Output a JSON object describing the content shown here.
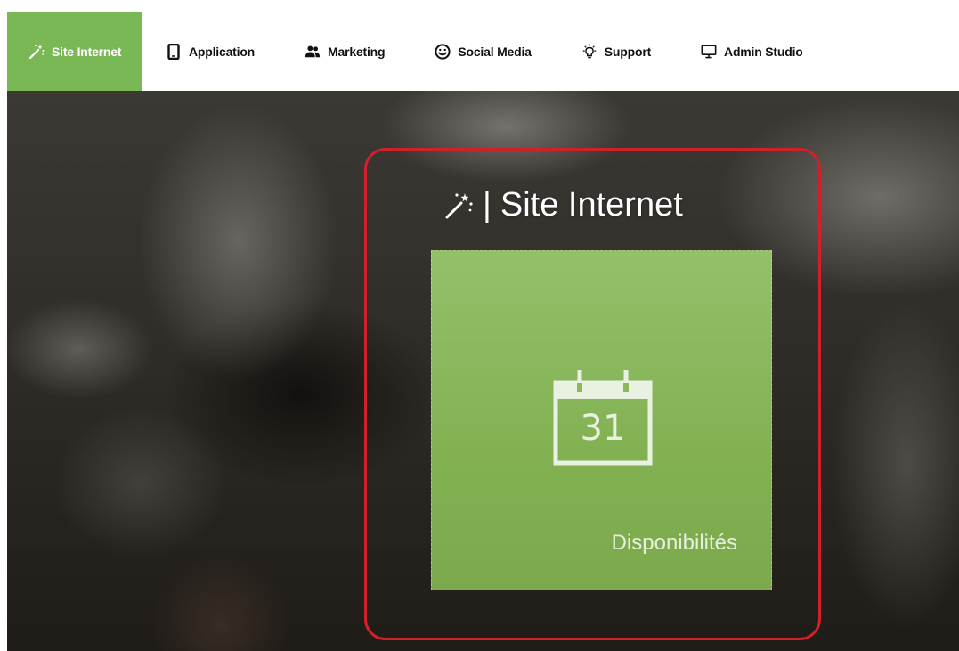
{
  "nav": {
    "items": [
      {
        "label": "Site Internet",
        "icon": "magic-wand-icon",
        "active": true
      },
      {
        "label": "Application",
        "icon": "mobile-icon",
        "active": false
      },
      {
        "label": "Marketing",
        "icon": "users-icon",
        "active": false
      },
      {
        "label": "Social Media",
        "icon": "smiley-icon",
        "active": false
      },
      {
        "label": "Support",
        "icon": "lightbulb-icon",
        "active": false
      },
      {
        "label": "Admin Studio",
        "icon": "monitor-icon",
        "active": false
      }
    ],
    "active_color": "#7ab855"
  },
  "section": {
    "separator": "|",
    "title": "Site Internet",
    "icon": "magic-wand-icon"
  },
  "tile": {
    "icon": "calendar-icon",
    "calendar_day": "31",
    "label": "Disponibilités",
    "color": "#86b458"
  },
  "highlight_color": "#d0202a"
}
